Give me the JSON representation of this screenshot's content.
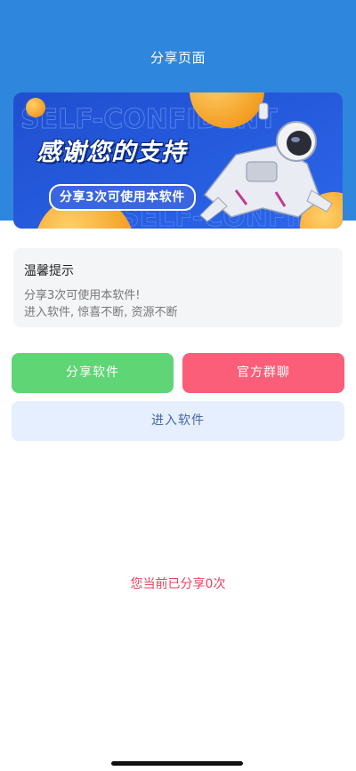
{
  "header": {
    "title": "分享页面"
  },
  "banner": {
    "headline": "感谢您的支持",
    "subline": "分享3次可使用本软件",
    "watermark": "SELF-CONFIDENT"
  },
  "tips": {
    "title": "温馨提示",
    "lines": [
      "分享3次可使用本软件!",
      "进入软件, 惊喜不断, 资源不断"
    ]
  },
  "actions": {
    "share_label": "分享软件",
    "group_label": "官方群聊",
    "enter_label": "进入软件"
  },
  "status": {
    "share_count_text": "您当前已分享0次"
  },
  "colors": {
    "header_bg": "#2f86dd",
    "share_button": "#5fd575",
    "group_button": "#fb5e78",
    "enter_button": "#e5efff",
    "count_text": "#e8435f"
  }
}
